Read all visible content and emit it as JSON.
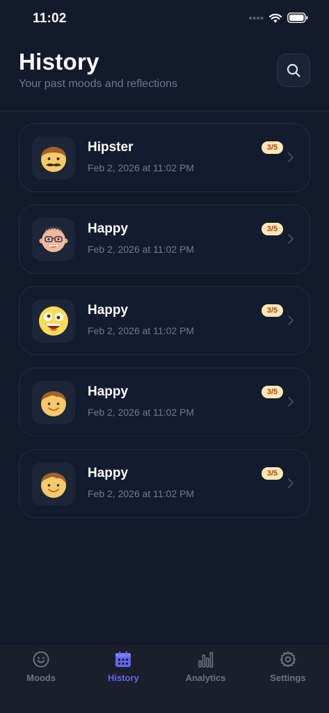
{
  "status": {
    "time": "11:02"
  },
  "header": {
    "title": "History",
    "subtitle": "Your past moods and reflections",
    "search_icon": "search-icon"
  },
  "entries": [
    {
      "mood": "Hipster",
      "date": "Feb 2, 2026 at 11:02 PM",
      "rating": "3/5",
      "avatar": "hipster-face-icon"
    },
    {
      "mood": "Happy",
      "date": "Feb 2, 2026 at 11:02 PM",
      "rating": "3/5",
      "avatar": "bald-glasses-face-icon"
    },
    {
      "mood": "Happy",
      "date": "Feb 2, 2026 at 11:02 PM",
      "rating": "3/5",
      "avatar": "laughing-emoji-icon"
    },
    {
      "mood": "Happy",
      "date": "Feb 2, 2026 at 11:02 PM",
      "rating": "3/5",
      "avatar": "smiling-boy-face-icon"
    },
    {
      "mood": "Happy",
      "date": "Feb 2, 2026 at 11:02 PM",
      "rating": "3/5",
      "avatar": "smiling-boy-face-icon"
    }
  ],
  "tabs": [
    {
      "label": "Moods",
      "icon": "smiley-icon",
      "active": false
    },
    {
      "label": "History",
      "icon": "calendar-icon",
      "active": true
    },
    {
      "label": "Analytics",
      "icon": "bar-chart-icon",
      "active": false
    },
    {
      "label": "Settings",
      "icon": "gear-icon",
      "active": false
    }
  ],
  "colors": {
    "background": "#121a2b",
    "accent": "#6366f1",
    "badge_bg": "#fde8b8",
    "badge_text": "#c2410c"
  }
}
